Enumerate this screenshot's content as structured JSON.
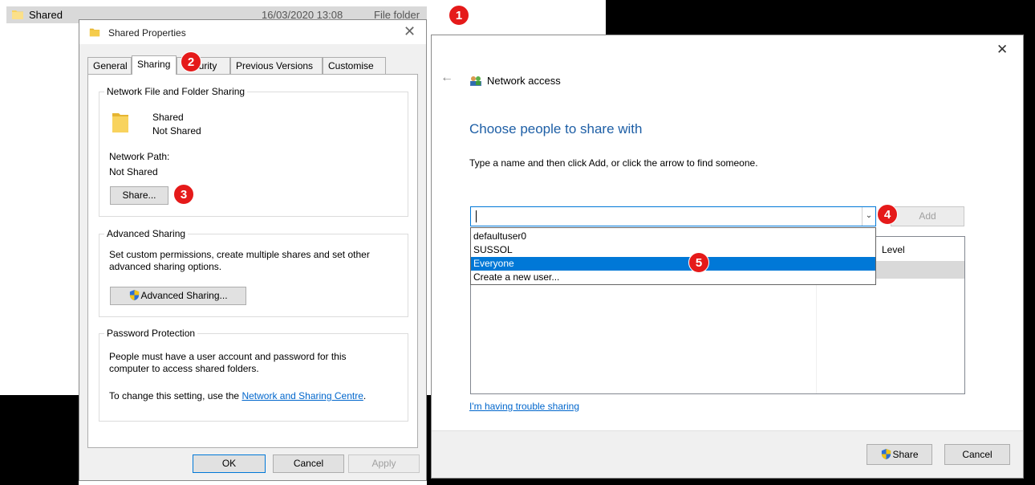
{
  "explorer_row": {
    "name": "Shared",
    "date": "16/03/2020 13:08",
    "type": "File folder"
  },
  "callouts": [
    "1",
    "2",
    "3",
    "4",
    "5"
  ],
  "properties": {
    "title": "Shared Properties",
    "close": "✕",
    "tabs": [
      "General",
      "Sharing",
      "Security",
      "Previous Versions",
      "Customise"
    ],
    "network_sharing": {
      "label": "Network File and Folder Sharing",
      "folder_name": "Shared",
      "status": "Not Shared",
      "network_path_label": "Network Path:",
      "network_path_value": "Not Shared",
      "share_button": "Share..."
    },
    "advanced_sharing": {
      "label": "Advanced Sharing",
      "description_line1": "Set custom permissions, create multiple shares and set other",
      "description_line2": "advanced sharing options.",
      "button": "Advanced Sharing..."
    },
    "password_protection": {
      "label": "Password Protection",
      "line1": "People must have a user account and password for this",
      "line2": "computer to access shared folders.",
      "line3_prefix": "To change this setting, use the ",
      "link": "Network and Sharing Centre",
      "line3_suffix": "."
    },
    "buttons": {
      "ok": "OK",
      "cancel": "Cancel",
      "apply": "Apply"
    }
  },
  "network_access": {
    "close": "✕",
    "back": "←",
    "window_title": "Network access",
    "heading": "Choose people to share with",
    "instruction": "Type a name and then click Add, or click the arrow to find someone.",
    "input_value": "",
    "add_button": "Add",
    "dropdown_options": [
      "defaultuser0",
      "SUSSOL",
      "Everyone",
      "Create a new user..."
    ],
    "selected_option": "Everyone",
    "permission_header": "Level",
    "trouble_link": "I'm having trouble sharing",
    "share_button": "Share",
    "cancel_button": "Cancel",
    "accent_color": "#0078d7",
    "heading_color": "#1e5fa6"
  }
}
